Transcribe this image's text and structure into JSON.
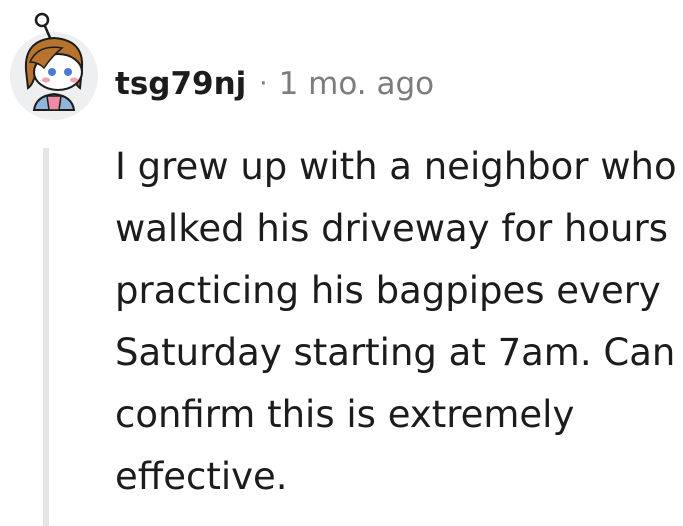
{
  "comment": {
    "author": "tsg79nj",
    "separator": "·",
    "timestamp": "1 mo. ago",
    "body": "I grew up with a neighbor who walked his driveway for hours practicing his bagpipes every Saturday starting at 7am. Can confirm this is extremely effective."
  },
  "icons": {
    "avatar": "snoo-avatar-icon"
  },
  "colors": {
    "text": "#1c1c1c",
    "meta": "#7c7c7c",
    "thread_line": "#e5e5e5",
    "avatar_bg": "#edeff1"
  }
}
